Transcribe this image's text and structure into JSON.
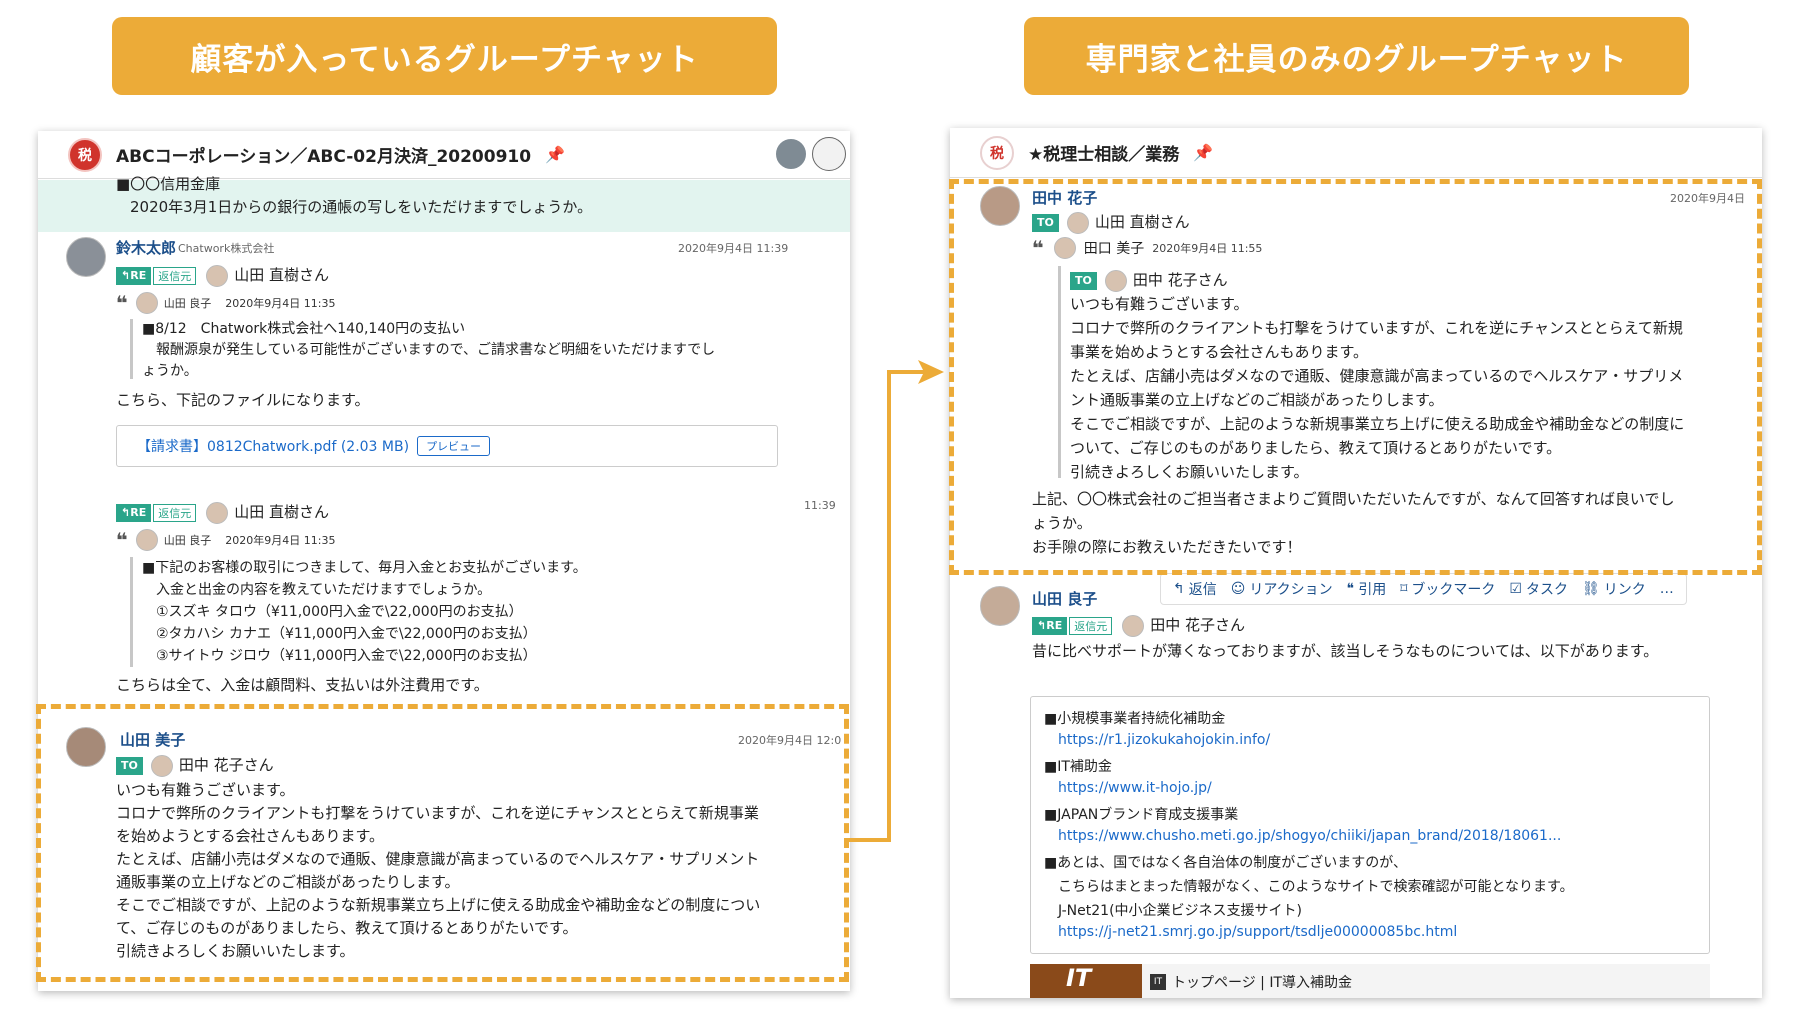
{
  "banners": {
    "left": "顧客が入っているグループチャット",
    "right": "専門家と社員のみのグループチャット"
  },
  "left_panel": {
    "room_icon": "税",
    "title": "ABCコーポレーション／ABC-02月決済_20200910",
    "top_message": {
      "line1": "■〇〇信用金庫",
      "line2": "2020年3月1日からの銀行の通帳の写しをいただけますでしょうか。"
    },
    "message1": {
      "sender": "鈴木太郎",
      "org": "Chatwork株式会社",
      "time": "2020年9月4日 11:39",
      "re_label": "RE",
      "src_label": "返信元",
      "reply_to": "山田 直樹さん",
      "quote_name": "山田 良子",
      "quote_time": "2020年9月4日 11:35",
      "quote_lines": [
        "■8/12　Chatwork株式会社へ140,140円の支払い",
        "報酬源泉が発生している可能性がございますので、ご請求書など明細をいただけますでし",
        "ょうか。"
      ],
      "body": "こちら、下記のファイルになります。",
      "file_label": "【請求書】0812Chatwork.pdf (2.03 MB)",
      "preview_label": "プレビュー"
    },
    "message2": {
      "time": "11:39",
      "re_label": "RE",
      "src_label": "返信元",
      "reply_to": "山田 直樹さん",
      "quote_name": "山田 良子",
      "quote_time": "2020年9月4日 11:35",
      "quote_lines": [
        "■下記のお客様の取引につきまして、毎月入金とお支払がございます。",
        "入金と出金の内容を教えていただけますでしょうか。",
        "①スズキ タロウ（¥11,000円入金で\\22,000円のお支払）",
        "②タカハシ カナエ（¥11,000円入金で\\22,000円のお支払）",
        "③サイトウ ジロウ（¥11,000円入金で\\22,000円のお支払）"
      ],
      "body": "こちらは全て、入金は顧問料、支払いは外注費用です。"
    },
    "message3": {
      "sender": "山田 美子",
      "time": "2020年9月4日 12:0",
      "to_label": "TO",
      "to_name": "田中 花子さん",
      "lines": [
        "いつも有難うございます。",
        "コロナで弊所のクライアントも打撃をうけていますが、これを逆にチャンスととらえて新規事業",
        "を始めようとする会社さんもあります。",
        "たとえば、店舗小売はダメなので通販、健康意識が高まっているのでヘルスケア・サプリメント",
        "通販事業の立上げなどのご相談があったりします。",
        "そこでご相談ですが、上記のような新規事業立ち上げに使える助成金や補助金などの制度につい",
        "て、ご存じのものがありましたら、教えて頂けるとありがたいです。",
        "引続きよろしくお願いいたします。"
      ]
    }
  },
  "right_panel": {
    "room_icon": "税",
    "title": "★税理士相談／業務",
    "message1": {
      "sender": "田中 花子",
      "time": "2020年9月4日",
      "to_label": "TO",
      "to_name": "山田 直樹さん",
      "quote_name": "田口 美子",
      "quote_time": "2020年9月4日 11:55",
      "quote_to_label": "TO",
      "quote_to_name": "田中 花子さん",
      "quote_lines": [
        "いつも有難うございます。",
        "コロナで弊所のクライアントも打撃をうけていますが、これを逆にチャンスととらえて新規",
        "事業を始めようとする会社さんもあります。",
        "たとえば、店舗小売はダメなので通販、健康意識が高まっているのでヘルスケア・サプリメ",
        "ント通販事業の立上げなどのご相談があったりします。",
        "そこでご相談ですが、上記のような新規事業立ち上げに使える助成金や補助金などの制度に",
        "ついて、ご存じのものがありましたら、教えて頂けるとありがたいです。",
        "引続きよろしくお願いいたします。"
      ],
      "body_lines": [
        "上記、〇〇株式会社のご担当者さまよりご質問いただいたんですが、なんて回答すれば良いでし",
        "ょうか。",
        "お手隙の際にお教えいただきたいです！"
      ]
    },
    "toolbar": {
      "reply": "返信",
      "reaction": "リアクション",
      "quote": "引用",
      "bookmark": "ブックマーク",
      "task": "タスク",
      "link": "リンク",
      "more": "…"
    },
    "message2": {
      "sender": "山田 良子",
      "re_label": "RE",
      "src_label": "返信元",
      "reply_to": "田中 花子さん",
      "body": "昔に比べサポートが薄くなっておりますが、該当しそうなものについては、以下があります。",
      "box_lines": [
        {
          "text": "■小規模事業者持続化補助金",
          "link": false
        },
        {
          "text": "https://r1.jizokukahojokin.info/",
          "link": true
        },
        {
          "text": "■IT補助金",
          "link": false
        },
        {
          "text": "https://www.it-hojo.jp/",
          "link": true
        },
        {
          "text": "■JAPANブランド育成支援事業",
          "link": false
        },
        {
          "text": "https://www.chusho.meti.go.jp/shogyo/chiiki/japan_brand/2018/18061...",
          "link": true
        },
        {
          "text": "■あとは、国ではなく各自治体の制度がございますのが、",
          "link": false
        },
        {
          "text": "こちらはまとまった情報がなく、このようなサイトで検索確認が可能となります。",
          "link": false
        },
        {
          "text": "J-Net21(中小企業ビジネス支援サイト)",
          "link": false
        },
        {
          "text": "https://j-net21.smrj.go.jp/support/tsdlje00000085bc.html",
          "link": true
        }
      ],
      "preview_thumb": "IT",
      "preview_title": "トップページ | IT導入補助金"
    }
  }
}
